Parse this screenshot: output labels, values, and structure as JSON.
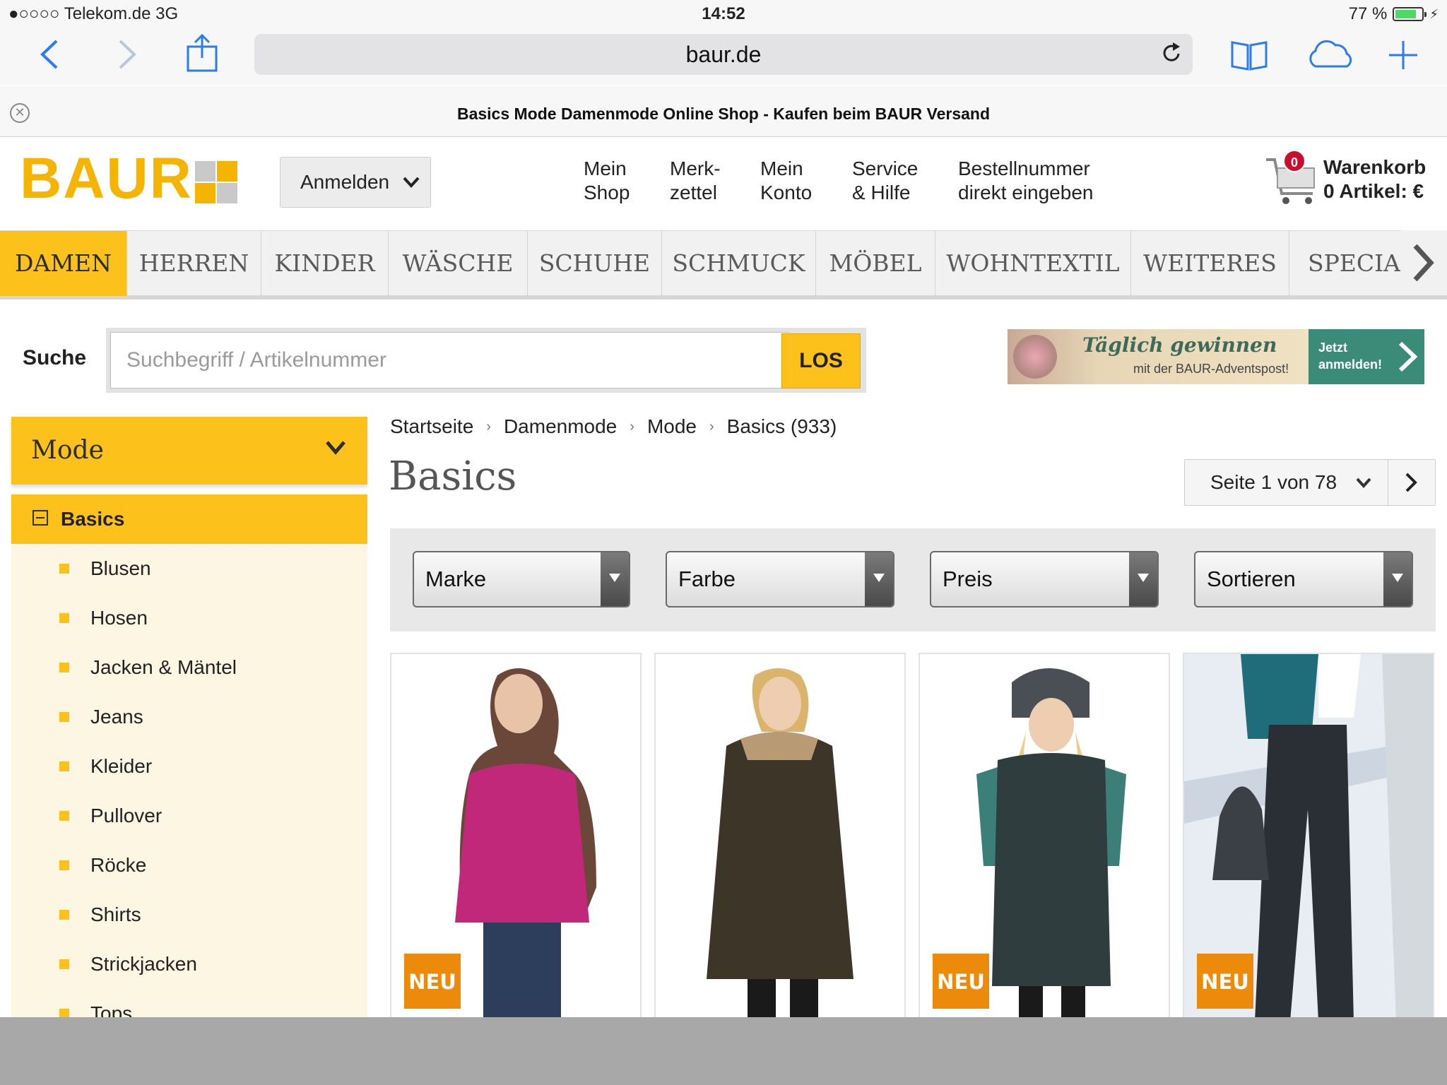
{
  "status_bar": {
    "carrier": "●○○○○ Telekom.de   3G",
    "time": "14:52",
    "battery_text": "77 %",
    "battery_level": 0.77
  },
  "browser": {
    "url": "baur.de",
    "tab_title": "Basics Mode Damenmode Online Shop - Kaufen beim BAUR Versand",
    "icons": [
      "back-icon",
      "forward-icon",
      "share-icon",
      "reload-icon",
      "bookmarks-icon",
      "icloud-tabs-icon",
      "new-tab-icon",
      "close-tab-icon"
    ]
  },
  "header": {
    "logo": "BAUR",
    "login_label": "Anmelden",
    "nav": [
      {
        "line1": "Mein",
        "line2": "Shop"
      },
      {
        "line1": "Merk-",
        "line2": "zettel"
      },
      {
        "line1": "Mein",
        "line2": "Konto"
      },
      {
        "line1": "Service",
        "line2": "& Hilfe"
      },
      {
        "line1": "Bestellnummer",
        "line2": "direkt eingeben"
      }
    ],
    "cart": {
      "badge": "0",
      "line1": "Warenkorb",
      "line2": "0 Artikel: €"
    }
  },
  "categories": [
    "DAMEN",
    "HERREN",
    "KINDER",
    "WÄSCHE",
    "SCHUHE",
    "SCHMUCK",
    "MÖBEL",
    "WOHNTEXTIL",
    "WEITERES",
    "SPECIAL"
  ],
  "active_category": "DAMEN",
  "search": {
    "label": "Suche",
    "placeholder": "Suchbegriff / Artikelnummer",
    "value": "",
    "button": "LOS"
  },
  "banner": {
    "headline": "Täglich gewinnen",
    "subline": "mit der BAUR-Adventspost!",
    "cta_line1": "Jetzt",
    "cta_line2": "anmelden!"
  },
  "sidebar": {
    "heading": "Mode",
    "active_item": "Basics",
    "items": [
      "Blusen",
      "Hosen",
      "Jacken & Mäntel",
      "Jeans",
      "Kleider",
      "Pullover",
      "Röcke",
      "Shirts",
      "Strickjacken",
      "Tops"
    ]
  },
  "breadcrumb": [
    "Startseite",
    "Damenmode",
    "Mode",
    "Basics (933)"
  ],
  "page": {
    "title": "Basics",
    "pager_label": "Seite 1 von 78"
  },
  "filters": [
    "Marke",
    "Farbe",
    "Preis",
    "Sortieren"
  ],
  "products": [
    {
      "badge": "NEU",
      "color": "#c2287a"
    },
    {
      "badge": "",
      "color": "#3d3528"
    },
    {
      "badge": "NEU",
      "color": "#2f3d3e"
    },
    {
      "badge": "NEU",
      "color": "#1f6d7a"
    }
  ],
  "colors": {
    "brand_yellow": "#fcc21b",
    "logo_yellow": "#f5b400",
    "badge_orange": "#ec8a0c",
    "ios_blue": "#2b7bf2"
  }
}
